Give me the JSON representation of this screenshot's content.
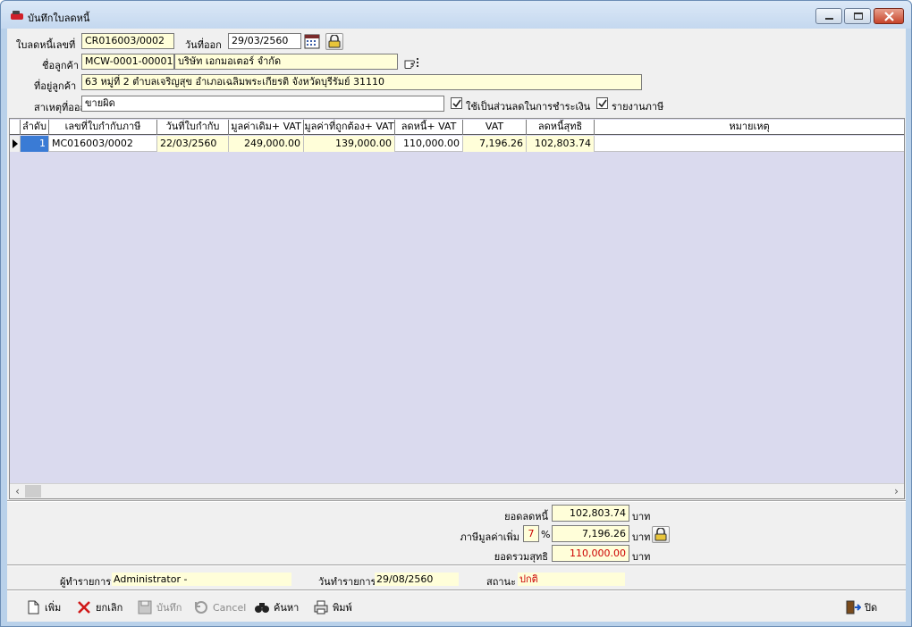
{
  "window": {
    "title": "บันทึกใบลดหนี้"
  },
  "form": {
    "doc_no_label": "ใบลดหนี้เลขที่",
    "doc_no": "CR016003/0002",
    "date_label": "วันที่ออก",
    "date": "29/03/2560",
    "customer_label": "ชื่อลูกค้า",
    "customer_code": "MCW-0001-00001",
    "customer_name": "บริษัท เอกมอเตอร์ จำกัด",
    "address_label": "ที่อยู่ลูกค้า",
    "address": "63 หมู่ที่ 2 ตำบลเจริญสุข อำเภอเฉลิมพระเกียรติ จังหวัดบุรีรัมย์ 31110",
    "reason_label": "สาเหตุที่ออก",
    "reason": "ขายผิด",
    "use_as_discount_label": "ใช้เป็นส่วนลดในการชำระเงิน",
    "use_as_discount_checked": true,
    "tax_report_label": "รายงานภาษี",
    "tax_report_checked": true
  },
  "grid": {
    "columns": [
      "ลำดับ",
      "เลขที่ใบกำกับภาษี",
      "วันที่ใบกำกับ",
      "มูลค่าเดิม+ VAT",
      "มูลค่าที่ถูกต้อง+ VAT",
      "ลดหนี้+ VAT",
      "VAT",
      "ลดหนี้สุทธิ",
      "หมายเหตุ"
    ],
    "rows": [
      {
        "no": "1",
        "invoice_no": "MC016003/0002",
        "invoice_date": "22/03/2560",
        "original": "249,000.00",
        "correct": "139,000.00",
        "credit": "110,000.00",
        "vat": "7,196.26",
        "net": "102,803.74",
        "remark": ""
      }
    ]
  },
  "summary": {
    "credit_label": "ยอดลดหนี้",
    "credit_value": "102,803.74",
    "vat_label": "ภาษีมูลค่าเพิ่ม",
    "vat_rate": "7",
    "vat_percent": "%",
    "vat_value": "7,196.26",
    "total_label": "ยอดรวมสุทธิ",
    "total_value": "110,000.00",
    "unit": "บาท"
  },
  "footer_info": {
    "creator_label": "ผู้ทำรายการ",
    "creator_value": "Administrator -",
    "txn_date_label": "วันทำรายการ",
    "txn_date_value": "29/08/2560",
    "status_label": "สถานะ",
    "status_value": "ปกติ"
  },
  "toolbar": {
    "add": "เพิ่ม",
    "cancel_doc": "ยกเลิก",
    "save": "บันทึก",
    "cancel": "Cancel",
    "search": "ค้นหา",
    "print": "พิมพ์",
    "close": "ปิด"
  },
  "colors": {
    "accent": "#3a7bd5",
    "status": "#cc0000",
    "field_bg": "#fffed9",
    "grid_bg": "#dadaee"
  }
}
